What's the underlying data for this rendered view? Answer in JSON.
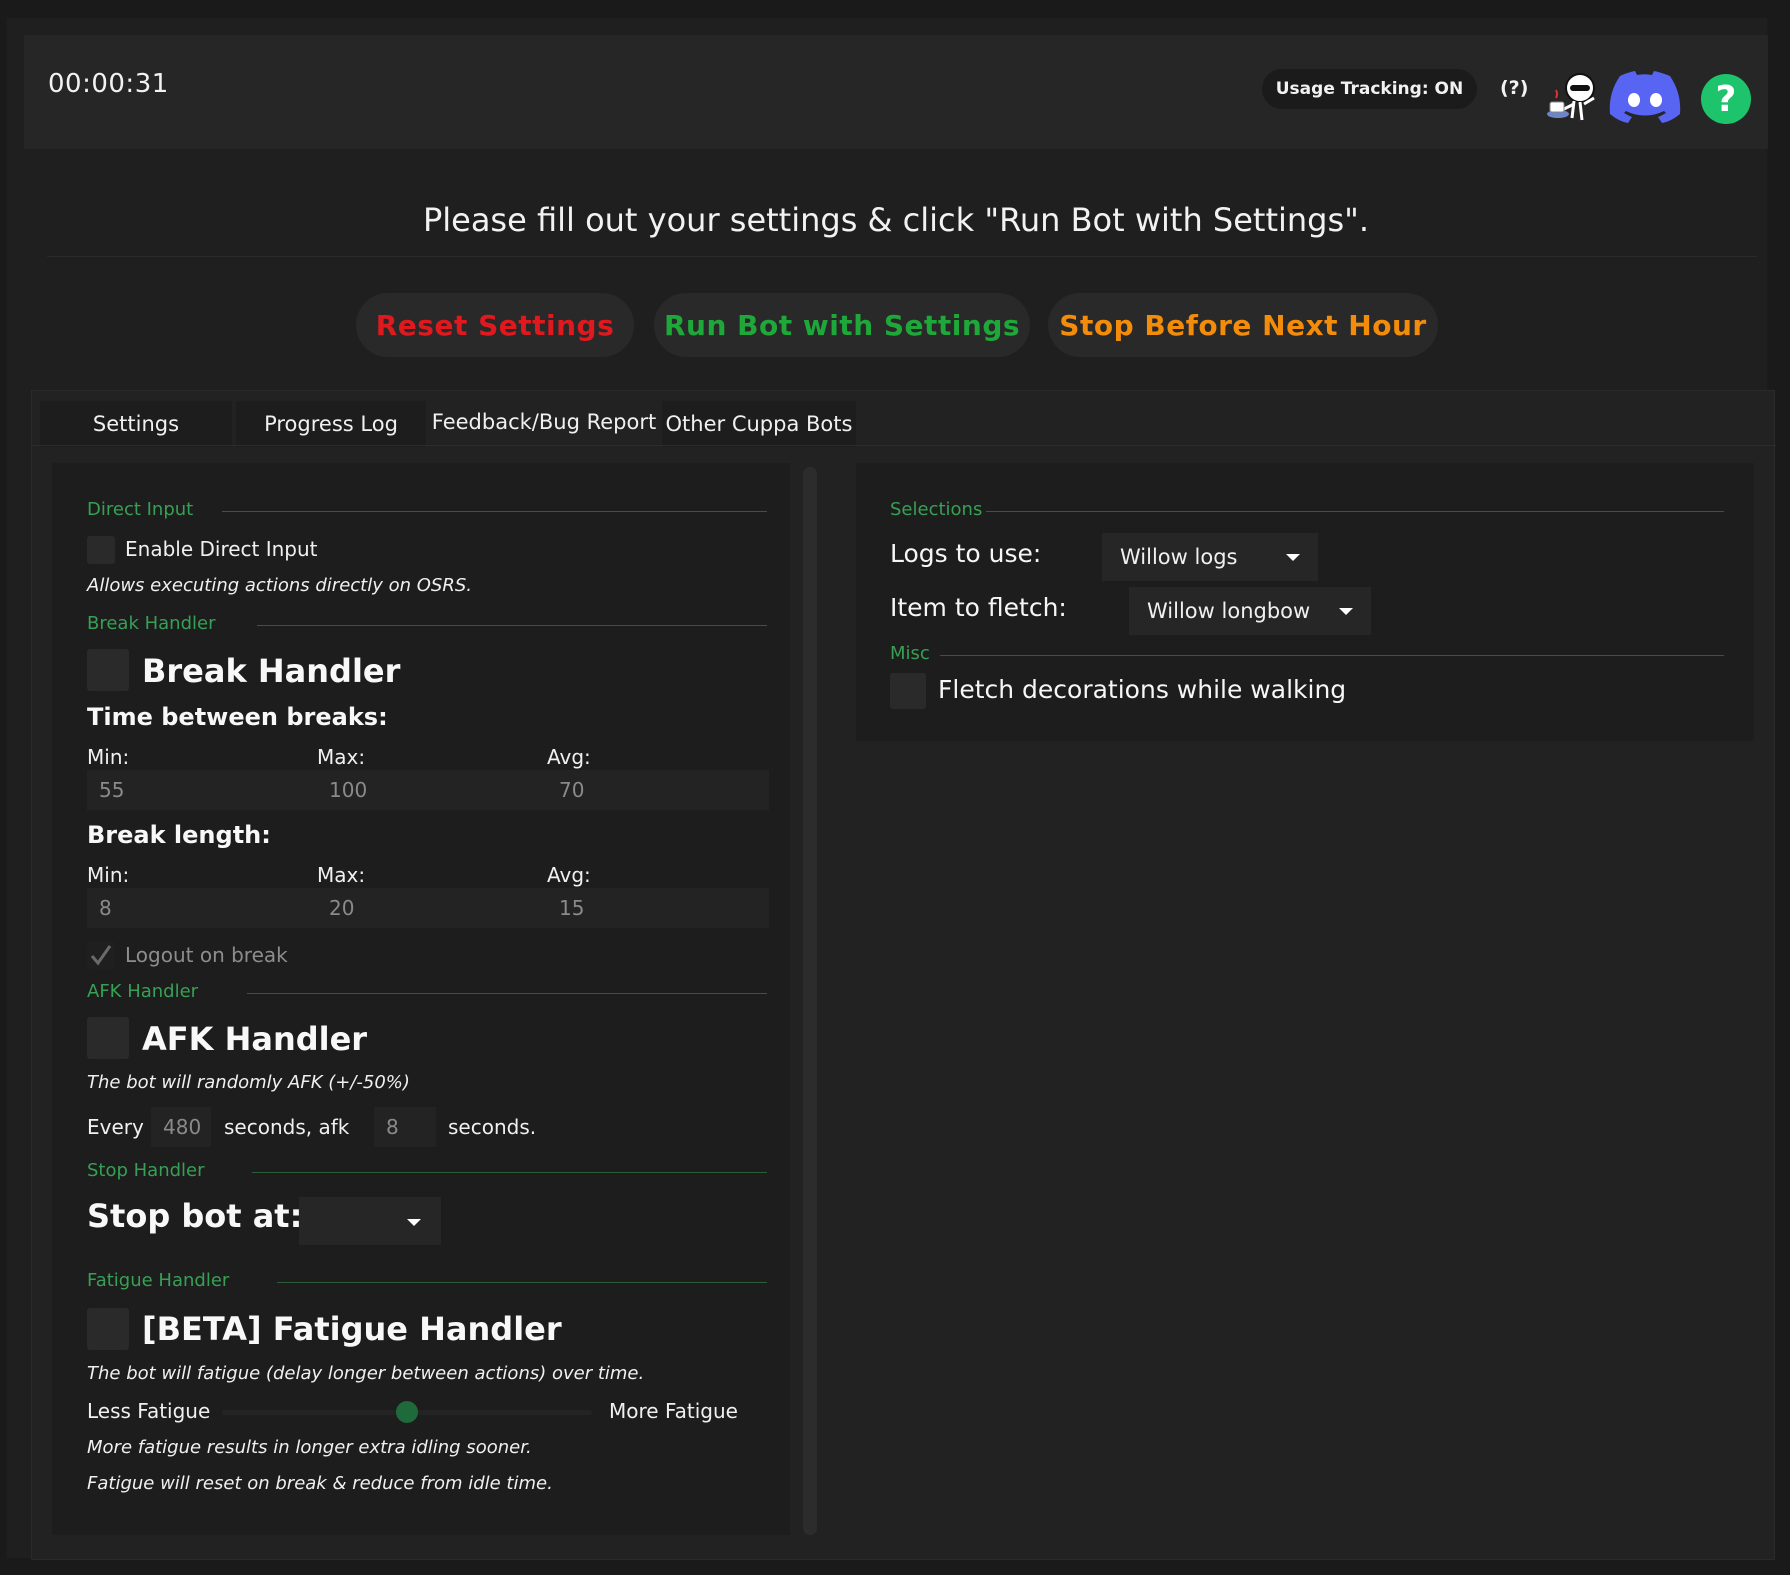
{
  "header": {
    "timer": "00:00:31",
    "usage_tracking": "Usage Tracking: ON",
    "usage_help": "(?)",
    "icons": [
      "cuppa-mascot-icon",
      "discord-icon",
      "help-icon"
    ]
  },
  "instruction": "Please fill out your settings & click \"Run Bot with Settings\".",
  "actions": {
    "reset": "Reset Settings",
    "run": "Run Bot with Settings",
    "stop": "Stop Before Next Hour"
  },
  "colors": {
    "reset": "#e0191e",
    "run": "#1fa83a",
    "stop": "#f28c0a",
    "group_title": "#37a055",
    "discord": "#5865f2",
    "help": "#1ec46b"
  },
  "tabs": [
    {
      "label": "Settings"
    },
    {
      "label": "Progress Log"
    },
    {
      "label": "Feedback/Bug Report"
    },
    {
      "label": "Other Cuppa Bots"
    }
  ],
  "left": {
    "direct_input": {
      "group": "Direct Input",
      "checkbox_label": "Enable Direct Input",
      "description": "Allows executing actions directly on OSRS."
    },
    "break_handler": {
      "group": "Break Handler",
      "title": "Break Handler",
      "time_between": "Time between breaks:",
      "min_label": "Min:",
      "max_label": "Max:",
      "avg_label": "Avg:",
      "between_min": "55",
      "between_max": "100",
      "between_avg": "70",
      "length_title": "Break length:",
      "length_min": "8",
      "length_max": "20",
      "length_avg": "15",
      "logout_label": "Logout on break"
    },
    "afk_handler": {
      "group": "AFK Handler",
      "title": "AFK Handler",
      "description": "The bot will randomly AFK (+/-50%)",
      "every": "Every",
      "every_value": "480",
      "seconds_afk": "seconds, afk",
      "afk_value": "8",
      "seconds": "seconds."
    },
    "stop_handler": {
      "group": "Stop Handler",
      "title": "Stop bot at:",
      "value": ""
    },
    "fatigue_handler": {
      "group": "Fatigue Handler",
      "title": "[BETA] Fatigue Handler",
      "description": "The bot will fatigue (delay longer between actions) over time.",
      "less": "Less Fatigue",
      "more": "More Fatigue",
      "slider_level": 0.5,
      "note1": "More fatigue results in longer extra idling sooner.",
      "note2": "Fatigue will reset on break & reduce from idle time."
    }
  },
  "right": {
    "selections": {
      "group": "Selections",
      "logs_label": "Logs to use:",
      "logs_value": "Willow logs",
      "item_label": "Item to fletch:",
      "item_value": "Willow longbow"
    },
    "misc": {
      "group": "Misc",
      "fletch_label": "Fletch decorations while walking"
    }
  }
}
